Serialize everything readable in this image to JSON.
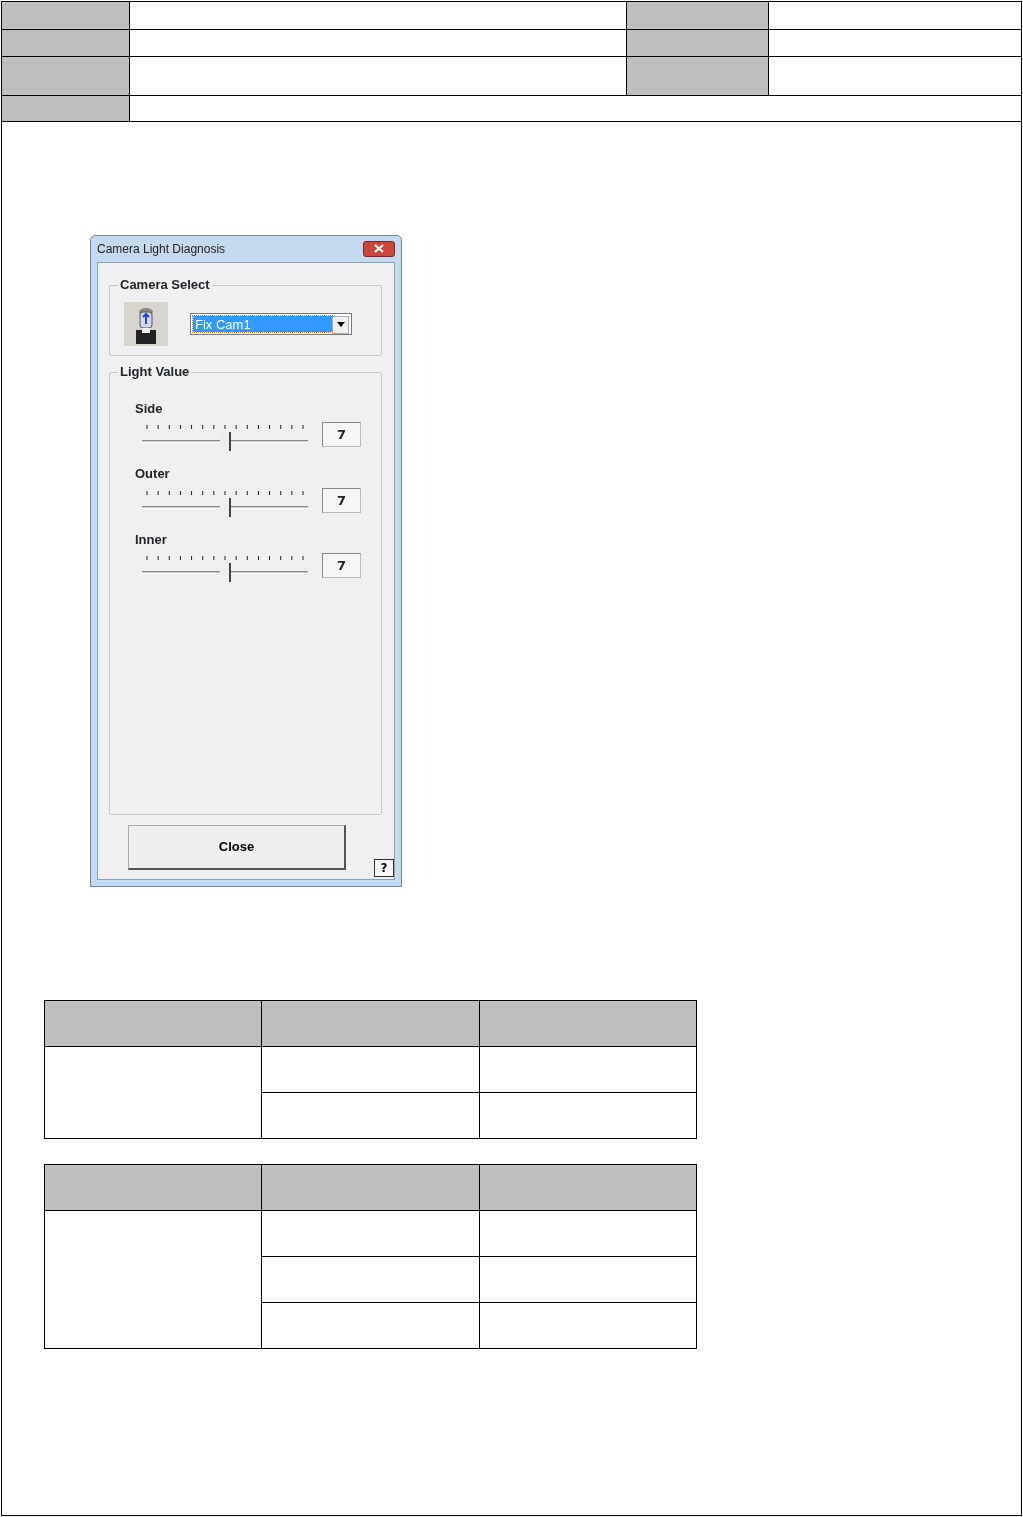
{
  "dialog": {
    "title": "Camera Light Diagnosis",
    "camera_select": {
      "label": "Camera Select",
      "value": "Fix Cam1"
    },
    "light_value": {
      "label": "Light Value",
      "sliders": [
        {
          "name": "Side",
          "level": 0.5,
          "reading": "7"
        },
        {
          "name": "Outer",
          "level": 0.5,
          "reading": "7"
        },
        {
          "name": "Inner",
          "level": 0.5,
          "reading": "7"
        }
      ]
    },
    "buttons": {
      "close": "Close",
      "help": "?"
    }
  }
}
